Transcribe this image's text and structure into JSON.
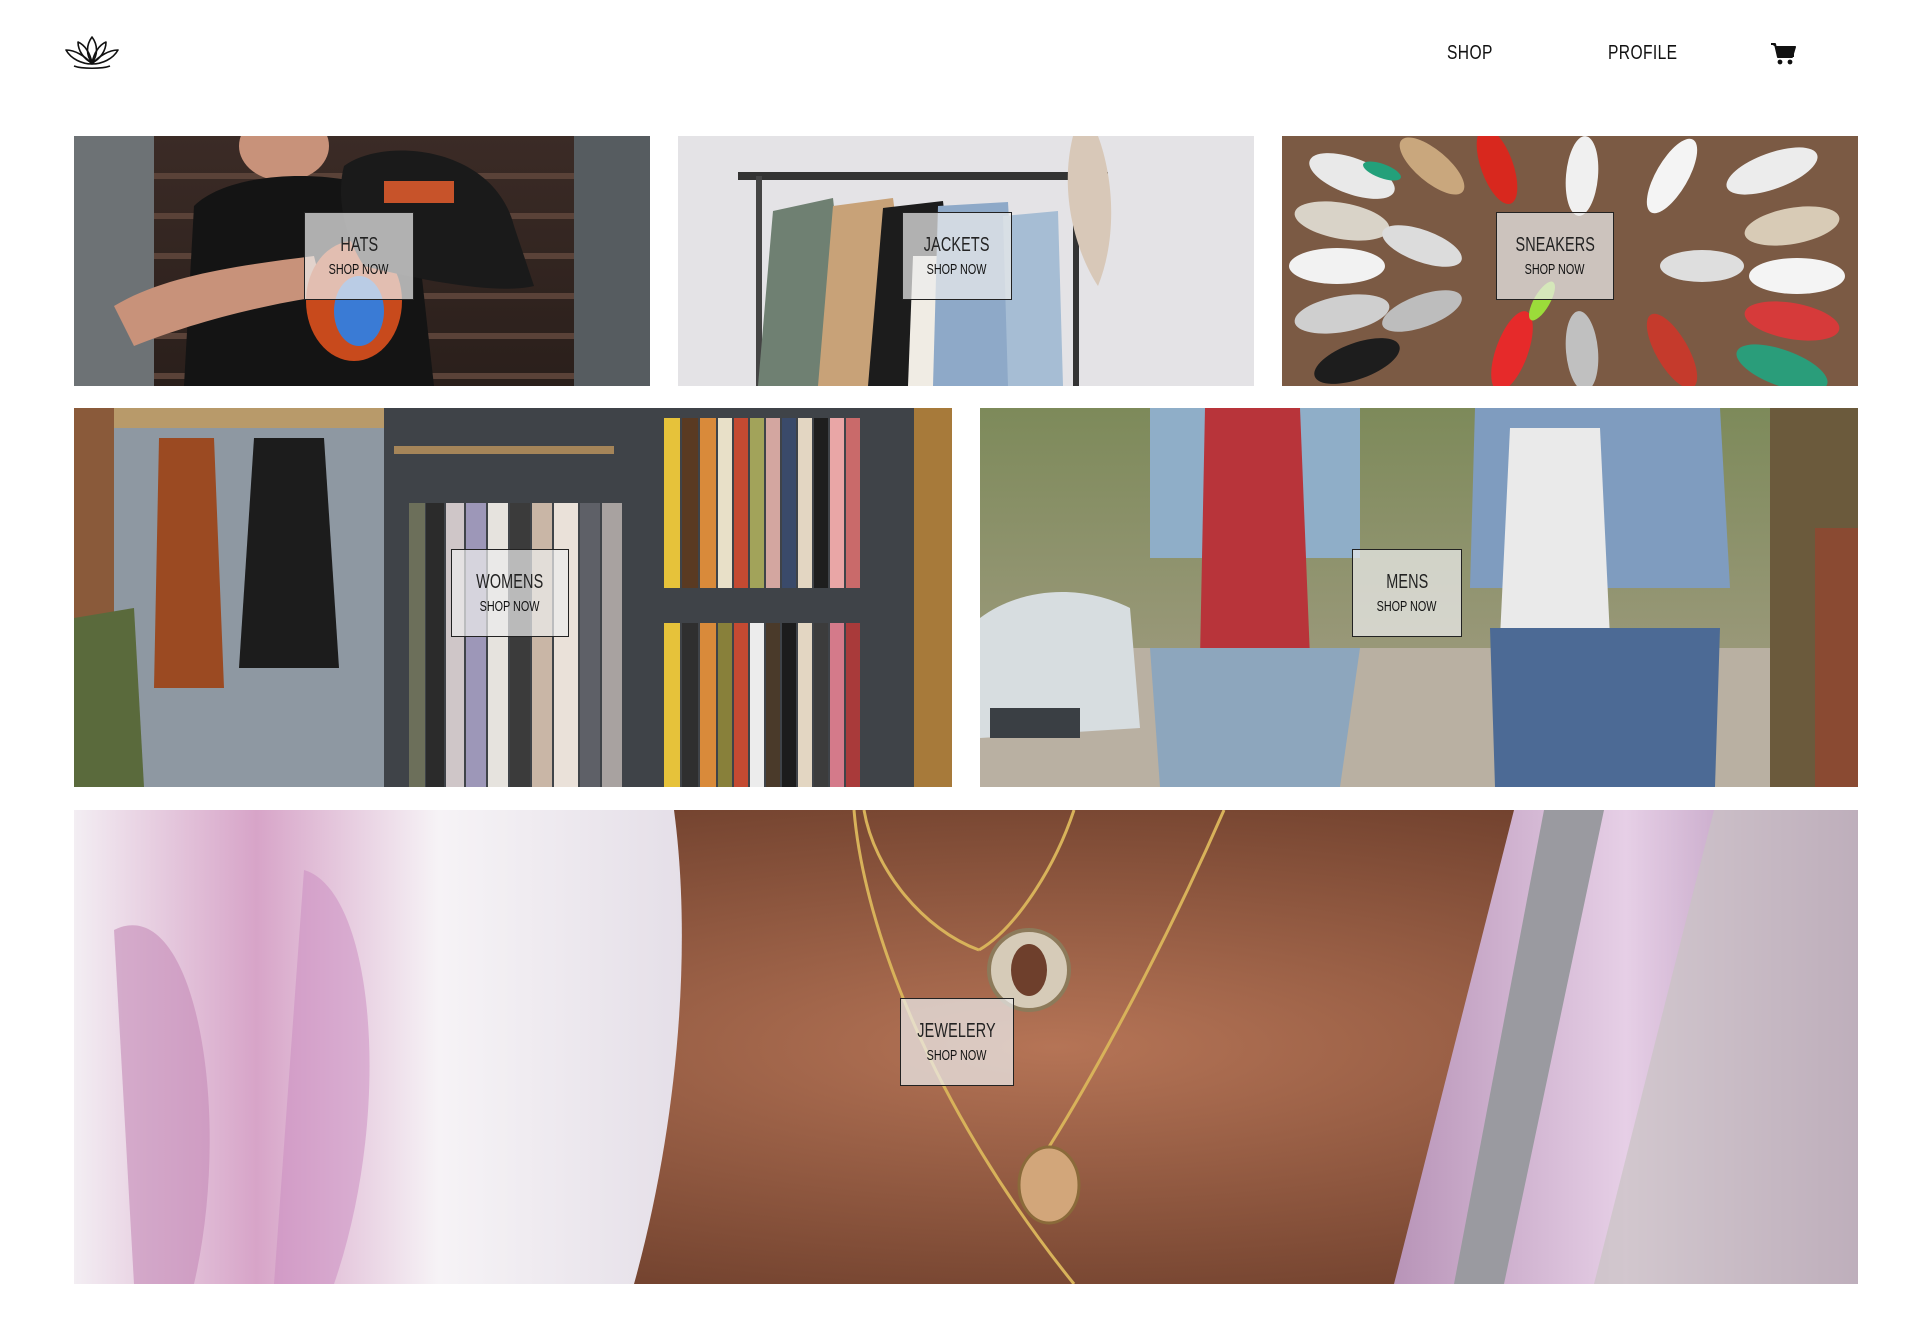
{
  "header": {
    "nav": {
      "shop": "SHOP",
      "profile": "PROFILE"
    },
    "icons": {
      "logo": "lotus-logo-icon",
      "cart": "cart-icon"
    }
  },
  "categories": [
    {
      "title": "HATS",
      "cta": "SHOP NOW"
    },
    {
      "title": "JACKETS",
      "cta": "SHOP NOW"
    },
    {
      "title": "SNEAKERS",
      "cta": "SHOP NOW"
    },
    {
      "title": "WOMENS",
      "cta": "SHOP NOW"
    },
    {
      "title": "MENS",
      "cta": "SHOP NOW"
    },
    {
      "title": "JEWELERY",
      "cta": "SHOP NOW"
    }
  ]
}
